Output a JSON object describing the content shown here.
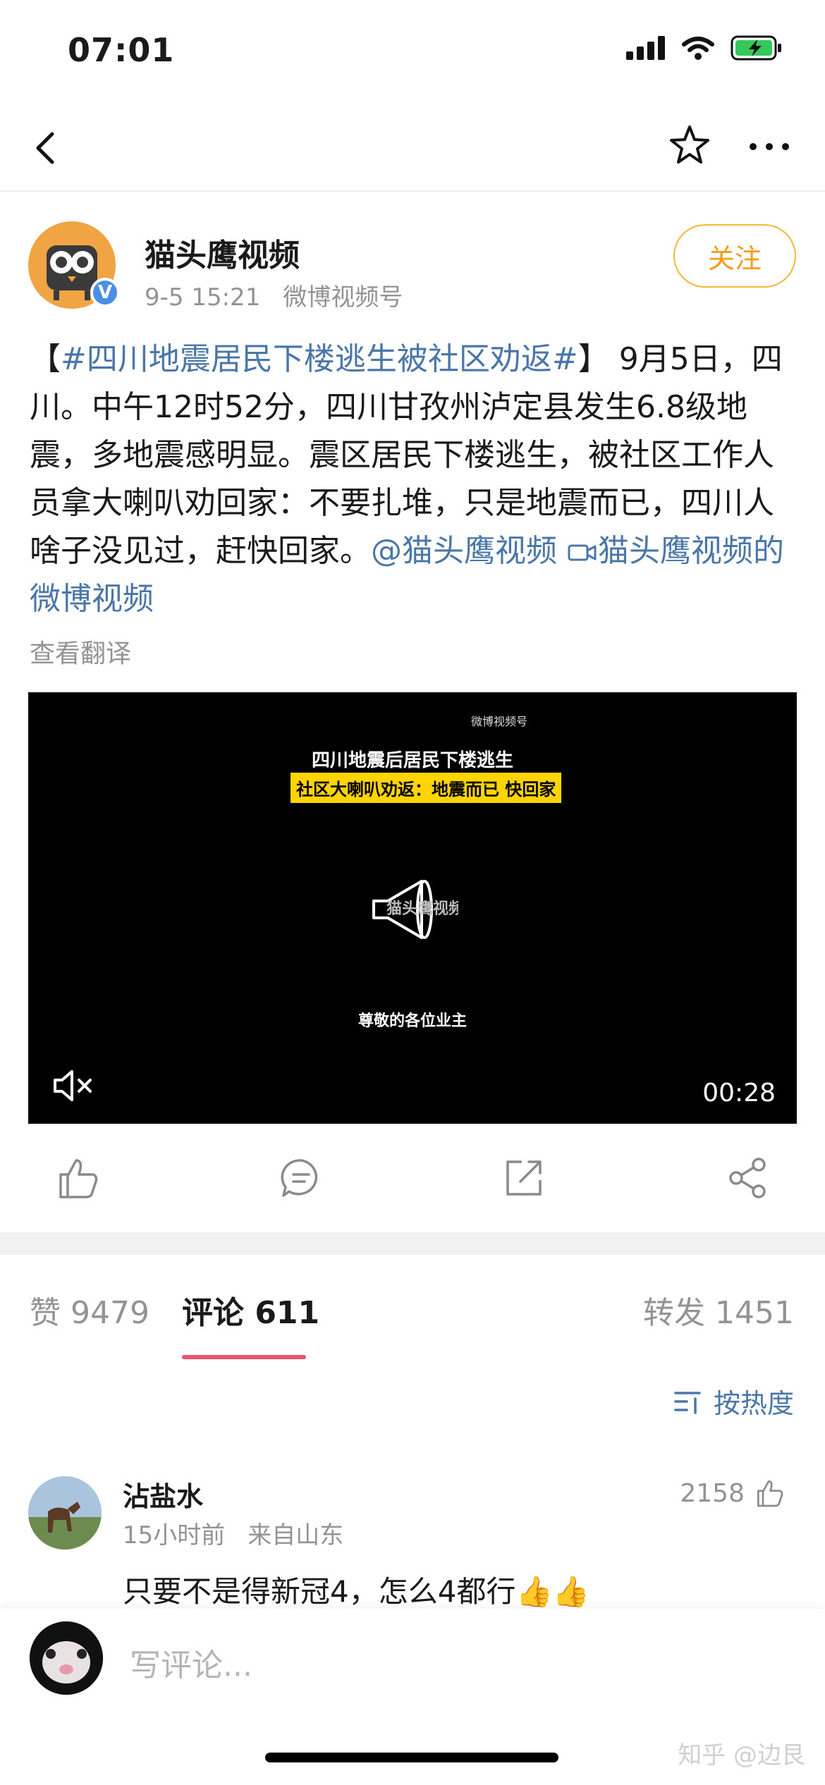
{
  "status_bar": {
    "time": "07:01"
  },
  "author": {
    "name": "猫头鹰视频",
    "date": "9-5 15:21",
    "source": "微博视频号",
    "follow_label": "关注",
    "verified_mark": "V"
  },
  "post": {
    "hashtag": "#四川地震居民下楼逃生被社区劝返#",
    "bracket_open": "【",
    "bracket_close": "】",
    "text": " 9月5日，四川。中午12时52分，四川甘孜州泸定县发生6.8级地震，多地震感明显。震区居民下楼逃生，被社区工作人员拿大喇叭劝回家：不要扎堆，只是地震而已，四川人啥子没见过，赶快回家。",
    "mention": "@猫头鹰视频",
    "video_link": "猫头鹰视频的微博视频",
    "translate_label": "查看翻译"
  },
  "video": {
    "watermark": "微博视频号",
    "title": "四川地震后居民下楼逃生",
    "subtitle": "社区大喇叭劝返：地震而已 快回家",
    "logo_text": "猫头鹰视频",
    "caption": "尊敬的各位业主",
    "duration": "00:28"
  },
  "tabs": {
    "likes": "赞 9479",
    "comments": "评论 611",
    "reposts": "转发 1451",
    "sort_label": "按热度"
  },
  "comment": {
    "name": "沾盐水",
    "time": "15小时前",
    "location": "来自山东",
    "likes": "2158",
    "text": "只要不是得新冠4，怎么4都行👍👍"
  },
  "compose": {
    "placeholder": "写评论..."
  },
  "watermark": "知乎 @边艮",
  "colors": {
    "link": "#4a76a8",
    "follow": "#f39c1f",
    "tab_underline": "#e9546b"
  }
}
